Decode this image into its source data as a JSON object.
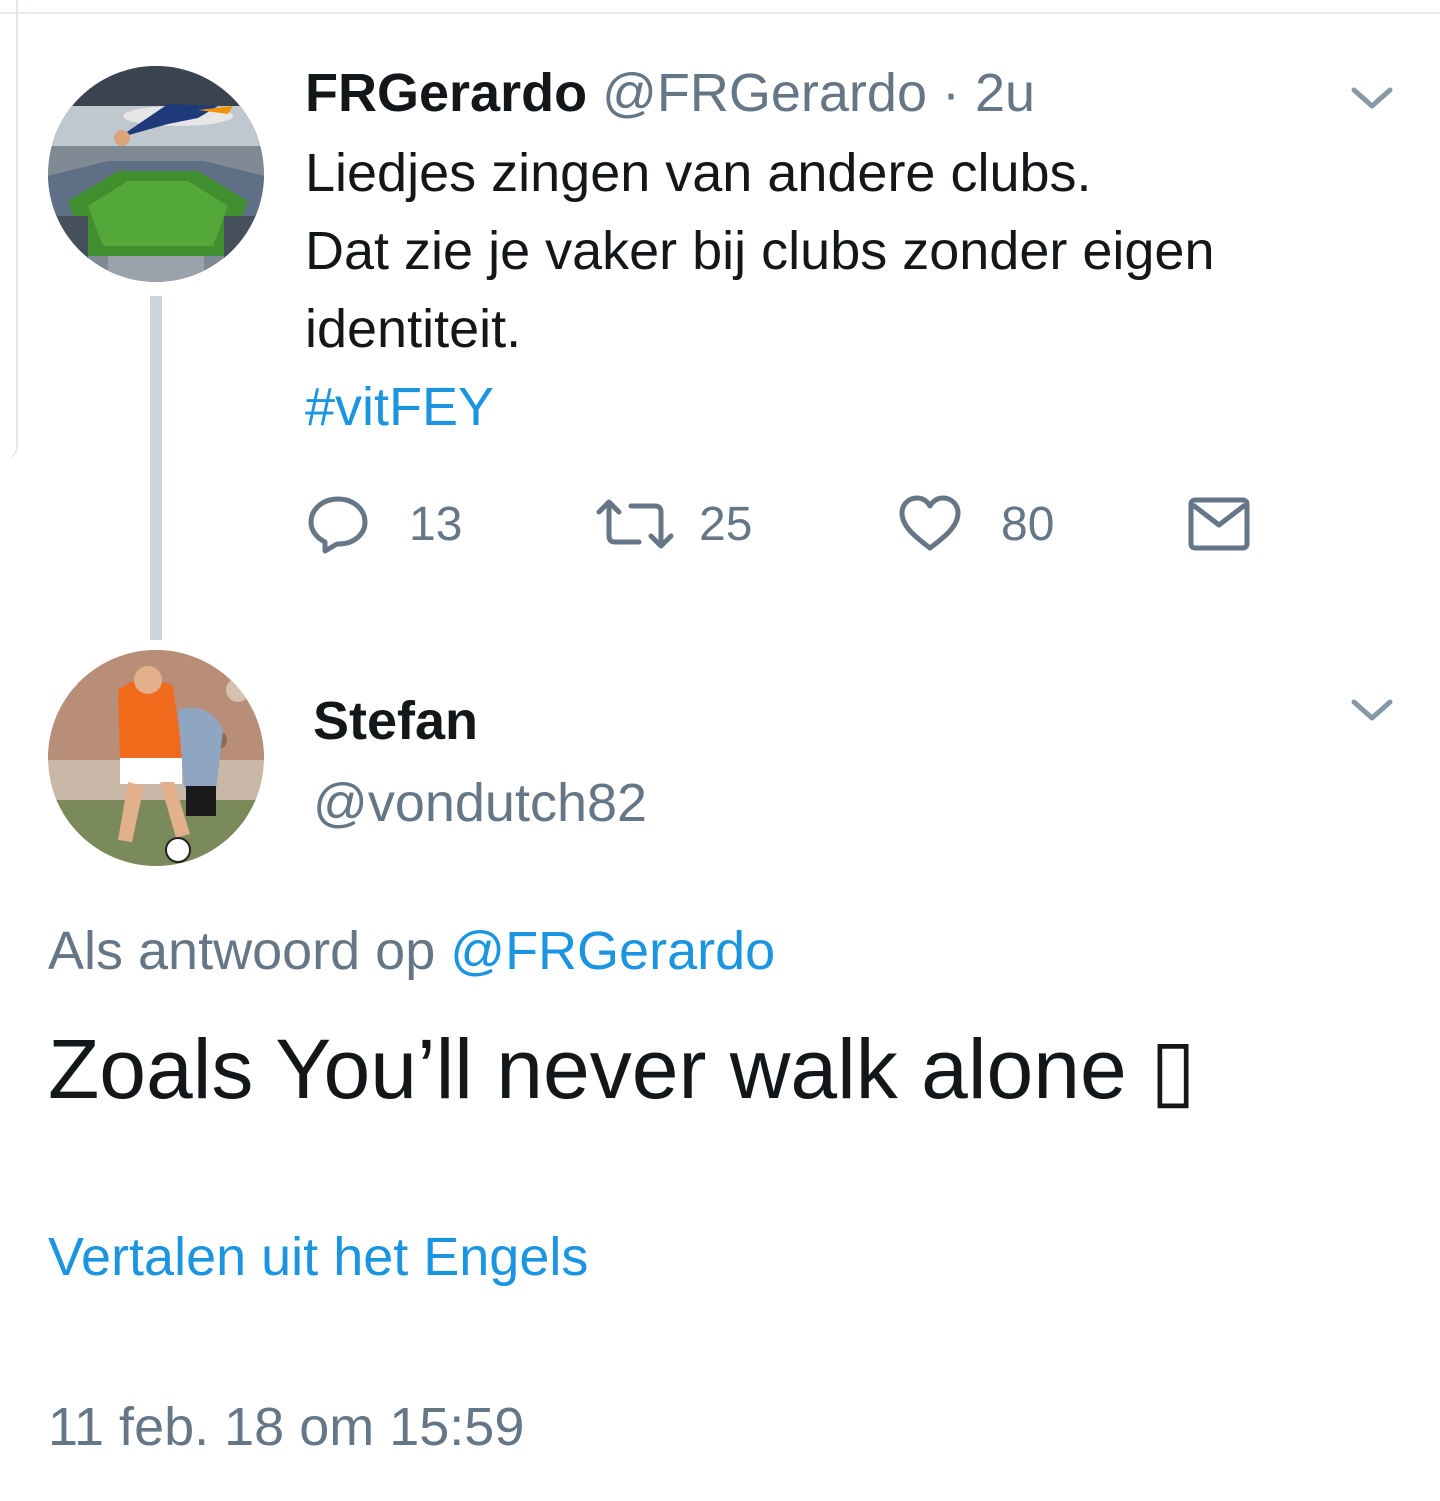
{
  "parent_tweet": {
    "display_name": "FRGerardo",
    "handle": "@FRGerardo",
    "separator": "·",
    "time": "2u",
    "text_lines": [
      "Liedjes zingen van andere clubs.",
      "Dat zie je vaker bij clubs zonder eigen",
      "identiteit."
    ],
    "hashtag": "#vitFEY",
    "actions": {
      "reply_count": "13",
      "retweet_count": "25",
      "like_count": "80"
    },
    "icons": [
      "chevron-down-icon",
      "reply-icon",
      "retweet-icon",
      "heart-icon",
      "envelope-icon"
    ]
  },
  "reply_tweet": {
    "display_name": "Stefan",
    "handle": "@vondutch82",
    "reply_to_label": "Als antwoord op",
    "reply_to_mention": "@FRGerardo",
    "text": "Zoals You’ll never walk alone ",
    "emoji_placeholder": "▯",
    "translate_label": "Vertalen uit het Engels",
    "timestamp": "11 feb. 18 om 15:59"
  },
  "colors": {
    "text": "#14171a",
    "secondary": "#657786",
    "link": "#1b95e0",
    "thread_line": "#ccd6dd"
  }
}
